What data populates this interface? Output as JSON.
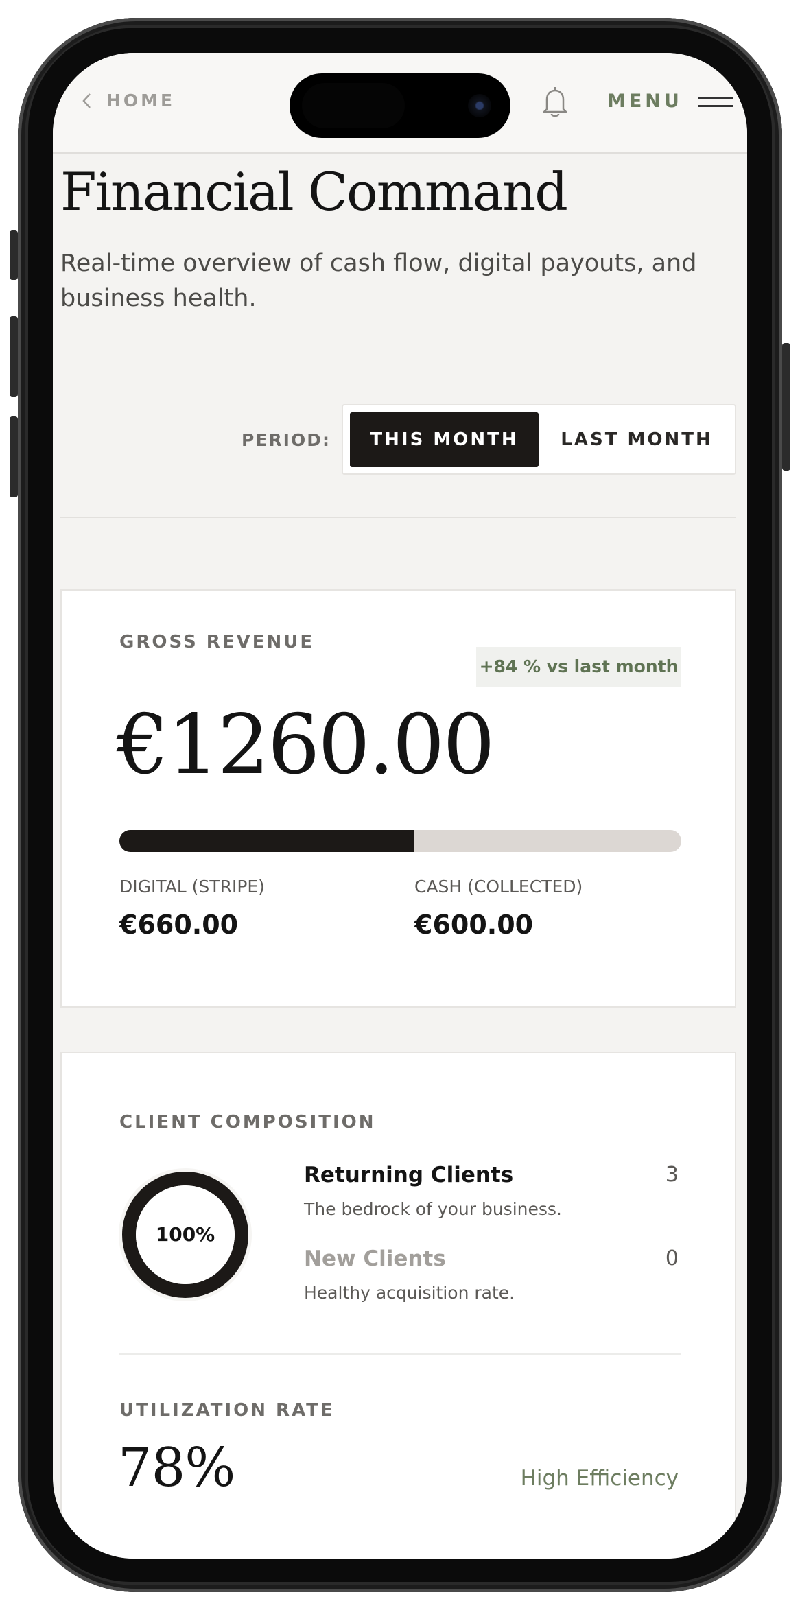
{
  "nav": {
    "back_label": "HOME",
    "menu_label": "MENU"
  },
  "header": {
    "title": "Financial Command",
    "subtitle": "Real-time overview of cash flow, digital payouts, and business health."
  },
  "period": {
    "label": "PERIOD:",
    "options": [
      "THIS MONTH",
      "LAST MONTH"
    ],
    "selected": "THIS MONTH"
  },
  "revenue": {
    "label": "GROSS REVENUE",
    "delta": "+84 % vs last month",
    "amount": "€1260.00",
    "digital_share": 0.524,
    "digital_label": "DIGITAL (STRIPE)",
    "digital_value": "€660.00",
    "cash_label": "CASH (COLLECTED)",
    "cash_value": "€600.00"
  },
  "clients": {
    "label": "CLIENT COMPOSITION",
    "returning_pct": "100%",
    "returning_fraction": 1.0,
    "items": [
      {
        "title": "Returning Clients",
        "desc": "The bedrock of your business.",
        "count": "3"
      },
      {
        "title": "New Clients",
        "desc": "Healthy acquisition rate.",
        "count": "0"
      }
    ]
  },
  "utilization": {
    "label": "UTILIZATION RATE",
    "value": "78%",
    "status": "High Efficiency"
  },
  "colors": {
    "accent": "#6d7d60",
    "dark": "#1c1917",
    "background": "#f4f3f1",
    "bar_track": "#dcd7d3"
  },
  "icons": [
    "chevron-left-icon",
    "bell-icon",
    "hamburger-icon"
  ]
}
